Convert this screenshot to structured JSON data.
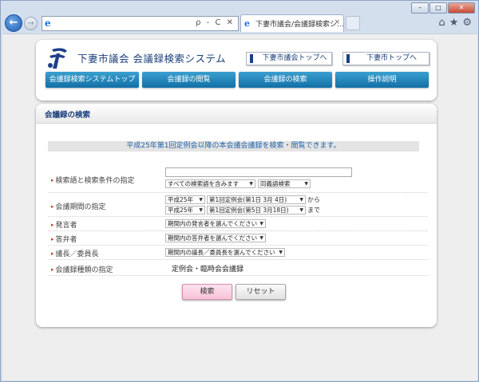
{
  "browser": {
    "window_controls": [
      "–",
      "□",
      "✕"
    ],
    "tab_title": "下妻市議会/会議録検索シ...",
    "tab_close": "×",
    "address_icon": "e",
    "address_actions": "ρ - C ✕",
    "tool_icons": [
      "⌂",
      "★",
      "⚙"
    ]
  },
  "header": {
    "site_title": "下妻市議会 会議録検索システム",
    "links": [
      "下妻市議会トップへ",
      "下妻市トップへ"
    ],
    "nav": [
      "会議録検索システムトップ",
      "会議録の閲覧",
      "会議録の検索",
      "操作説明"
    ]
  },
  "main": {
    "heading": "会議録の検索",
    "notice": "平成25年第1回定例会以降の本会議会議録を検索・閲覧できます。",
    "rows": {
      "keyword": {
        "label": "検索語と検索条件の指定",
        "input_value": "",
        "condition": "すべての検索語を含みます",
        "synonym": "同義語検索"
      },
      "period": {
        "label": "会議期間の指定",
        "from_year": "平成25年",
        "from_session": "第1回定例会(第1日 3月 4日)",
        "from_suffix": "から",
        "to_year": "平成25年",
        "to_session": "第1回定例会(第5日 3月18日)",
        "to_suffix": "まで"
      },
      "speaker": {
        "label": "発言者",
        "value": "期間内の発言者を選んでください"
      },
      "answerer": {
        "label": "答弁者",
        "value": "期間内の答弁者を選んでください"
      },
      "chair": {
        "label": "議長／委員長",
        "value": "期間内の議長／委員長を選んでください"
      },
      "type": {
        "label": "会議録種類の指定",
        "value": "定例会・臨時会会議録"
      }
    },
    "buttons": {
      "search": "検索",
      "reset": "リセット"
    }
  },
  "colors": {
    "nav_blue": "#126fa6",
    "title_navy": "#1a3f7a",
    "notice_blue": "#2463a8",
    "search_pink": "#f7c3d8"
  }
}
